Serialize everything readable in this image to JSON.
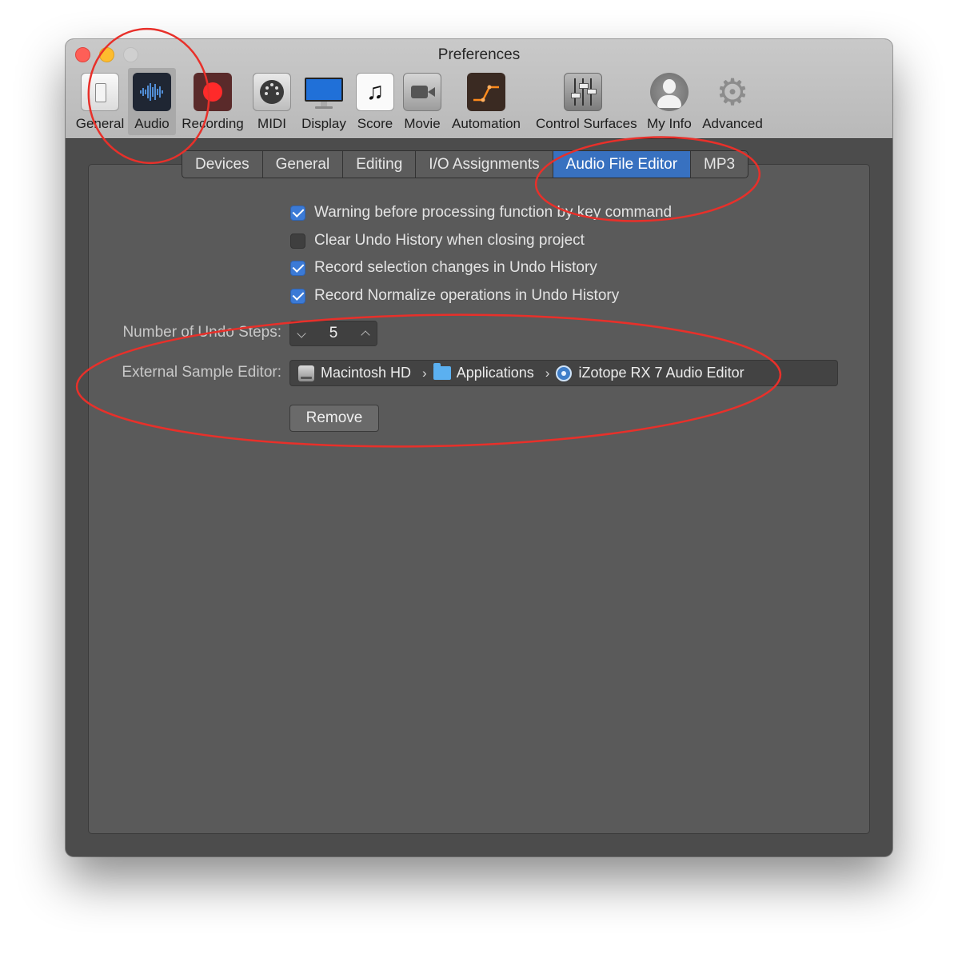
{
  "window": {
    "title": "Preferences"
  },
  "toolbar": {
    "items": [
      {
        "label": "General",
        "icon": "switch-icon",
        "selected": false
      },
      {
        "label": "Audio",
        "icon": "waveform-icon",
        "selected": true
      },
      {
        "label": "Recording",
        "icon": "record-icon",
        "selected": false
      },
      {
        "label": "MIDI",
        "icon": "midi-plug-icon",
        "selected": false
      },
      {
        "label": "Display",
        "icon": "monitor-icon",
        "selected": false
      },
      {
        "label": "Score",
        "icon": "music-note-icon",
        "selected": false
      },
      {
        "label": "Movie",
        "icon": "movie-camera-icon",
        "selected": false
      },
      {
        "label": "Automation",
        "icon": "automation-curve-icon",
        "selected": false
      },
      {
        "label": "Control Surfaces",
        "icon": "faders-icon",
        "selected": false
      },
      {
        "label": "My Info",
        "icon": "user-silhouette-icon",
        "selected": false
      },
      {
        "label": "Advanced",
        "icon": "gear-icon",
        "selected": false
      }
    ]
  },
  "tabs": [
    {
      "label": "Devices",
      "active": false
    },
    {
      "label": "General",
      "active": false
    },
    {
      "label": "Editing",
      "active": false
    },
    {
      "label": "I/O Assignments",
      "active": false
    },
    {
      "label": "Audio File Editor",
      "active": true
    },
    {
      "label": "MP3",
      "active": false
    }
  ],
  "options": [
    {
      "label": "Warning before processing function by key command",
      "checked": true
    },
    {
      "label": "Clear Undo History when closing project",
      "checked": false
    },
    {
      "label": "Record selection changes in Undo History",
      "checked": true
    },
    {
      "label": "Record Normalize operations in Undo History",
      "checked": true
    }
  ],
  "undo_steps": {
    "label": "Number of Undo Steps:",
    "value": "5"
  },
  "external_editor": {
    "label": "External Sample Editor:",
    "path": [
      "Macintosh HD",
      "Applications",
      "iZotope RX 7 Audio Editor"
    ],
    "separator": "›"
  },
  "remove_button": {
    "label": "Remove"
  },
  "colors": {
    "accent": "#3871c0",
    "annotation": "#e8302a",
    "panel": "#5a5a5a",
    "titlebar": "#c2c2c2"
  }
}
